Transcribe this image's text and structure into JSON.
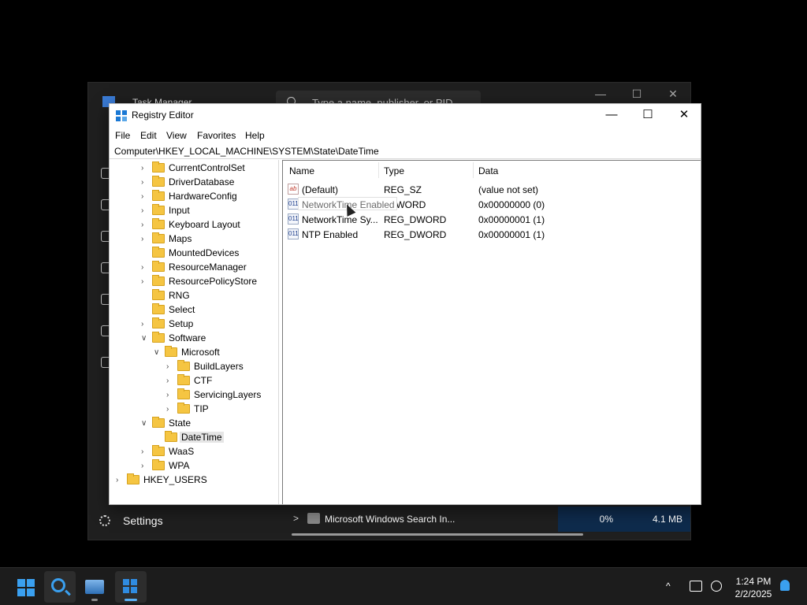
{
  "task_manager": {
    "title": "Task Manager",
    "search_placeholder": "Type a name, publisher, or PID",
    "settings_label": "Settings",
    "process_row": {
      "name": "Microsoft Windows Search In...",
      "cpu": "0%",
      "memory": "4.1 MB"
    }
  },
  "regedit": {
    "title": "Registry Editor",
    "menu": [
      "File",
      "Edit",
      "View",
      "Favorites",
      "Help"
    ],
    "address": "Computer\\HKEY_LOCAL_MACHINE\\SYSTEM\\State\\DateTime",
    "tree": [
      {
        "label": "CurrentControlSet",
        "level": 0,
        "toggle": ">"
      },
      {
        "label": "DriverDatabase",
        "level": 0,
        "toggle": ">"
      },
      {
        "label": "HardwareConfig",
        "level": 0,
        "toggle": ">"
      },
      {
        "label": "Input",
        "level": 0,
        "toggle": ">"
      },
      {
        "label": "Keyboard Layout",
        "level": 0,
        "toggle": ">"
      },
      {
        "label": "Maps",
        "level": 0,
        "toggle": ">"
      },
      {
        "label": "MountedDevices",
        "level": 0,
        "toggle": ""
      },
      {
        "label": "ResourceManager",
        "level": 0,
        "toggle": ">"
      },
      {
        "label": "ResourcePolicyStore",
        "level": 0,
        "toggle": ">"
      },
      {
        "label": "RNG",
        "level": 0,
        "toggle": ""
      },
      {
        "label": "Select",
        "level": 0,
        "toggle": ""
      },
      {
        "label": "Setup",
        "level": 0,
        "toggle": ">"
      },
      {
        "label": "Software",
        "level": 0,
        "toggle": "v"
      },
      {
        "label": "Microsoft",
        "level": 1,
        "toggle": "v"
      },
      {
        "label": "BuildLayers",
        "level": 2,
        "toggle": ">"
      },
      {
        "label": "CTF",
        "level": 2,
        "toggle": ">"
      },
      {
        "label": "ServicingLayers",
        "level": 2,
        "toggle": ">"
      },
      {
        "label": "TIP",
        "level": 2,
        "toggle": ">"
      },
      {
        "label": "State",
        "level": 0,
        "toggle": "v"
      },
      {
        "label": "DateTime",
        "level": 1,
        "toggle": "",
        "selected": true
      },
      {
        "label": "WaaS",
        "level": 0,
        "toggle": ">"
      },
      {
        "label": "WPA",
        "level": 0,
        "toggle": ">"
      },
      {
        "label": "HKEY_USERS",
        "level": -2,
        "toggle": ">"
      }
    ],
    "columns": {
      "name": "Name",
      "type": "Type",
      "data": "Data"
    },
    "values": [
      {
        "icon": "ab",
        "name": "(Default)",
        "type": "REG_SZ",
        "data": "(value not set)"
      },
      {
        "icon": "011",
        "name": "",
        "type": "_DWORD",
        "data": "0x00000000 (0)"
      },
      {
        "icon": "011",
        "name": "NetworkTime Sy...",
        "type": "REG_DWORD",
        "data": "0x00000001 (1)"
      },
      {
        "icon": "011",
        "name": "NTP Enabled",
        "type": "REG_DWORD",
        "data": "0x00000001 (1)"
      }
    ],
    "drag_text": "NetworkTime Enabled"
  },
  "taskbar": {
    "time": "1:24 PM",
    "date": "2/2/2025"
  },
  "colors": {
    "accent": "#3aa0f0",
    "folder": "#f5c542",
    "dark_bg": "#1f1f1f"
  }
}
